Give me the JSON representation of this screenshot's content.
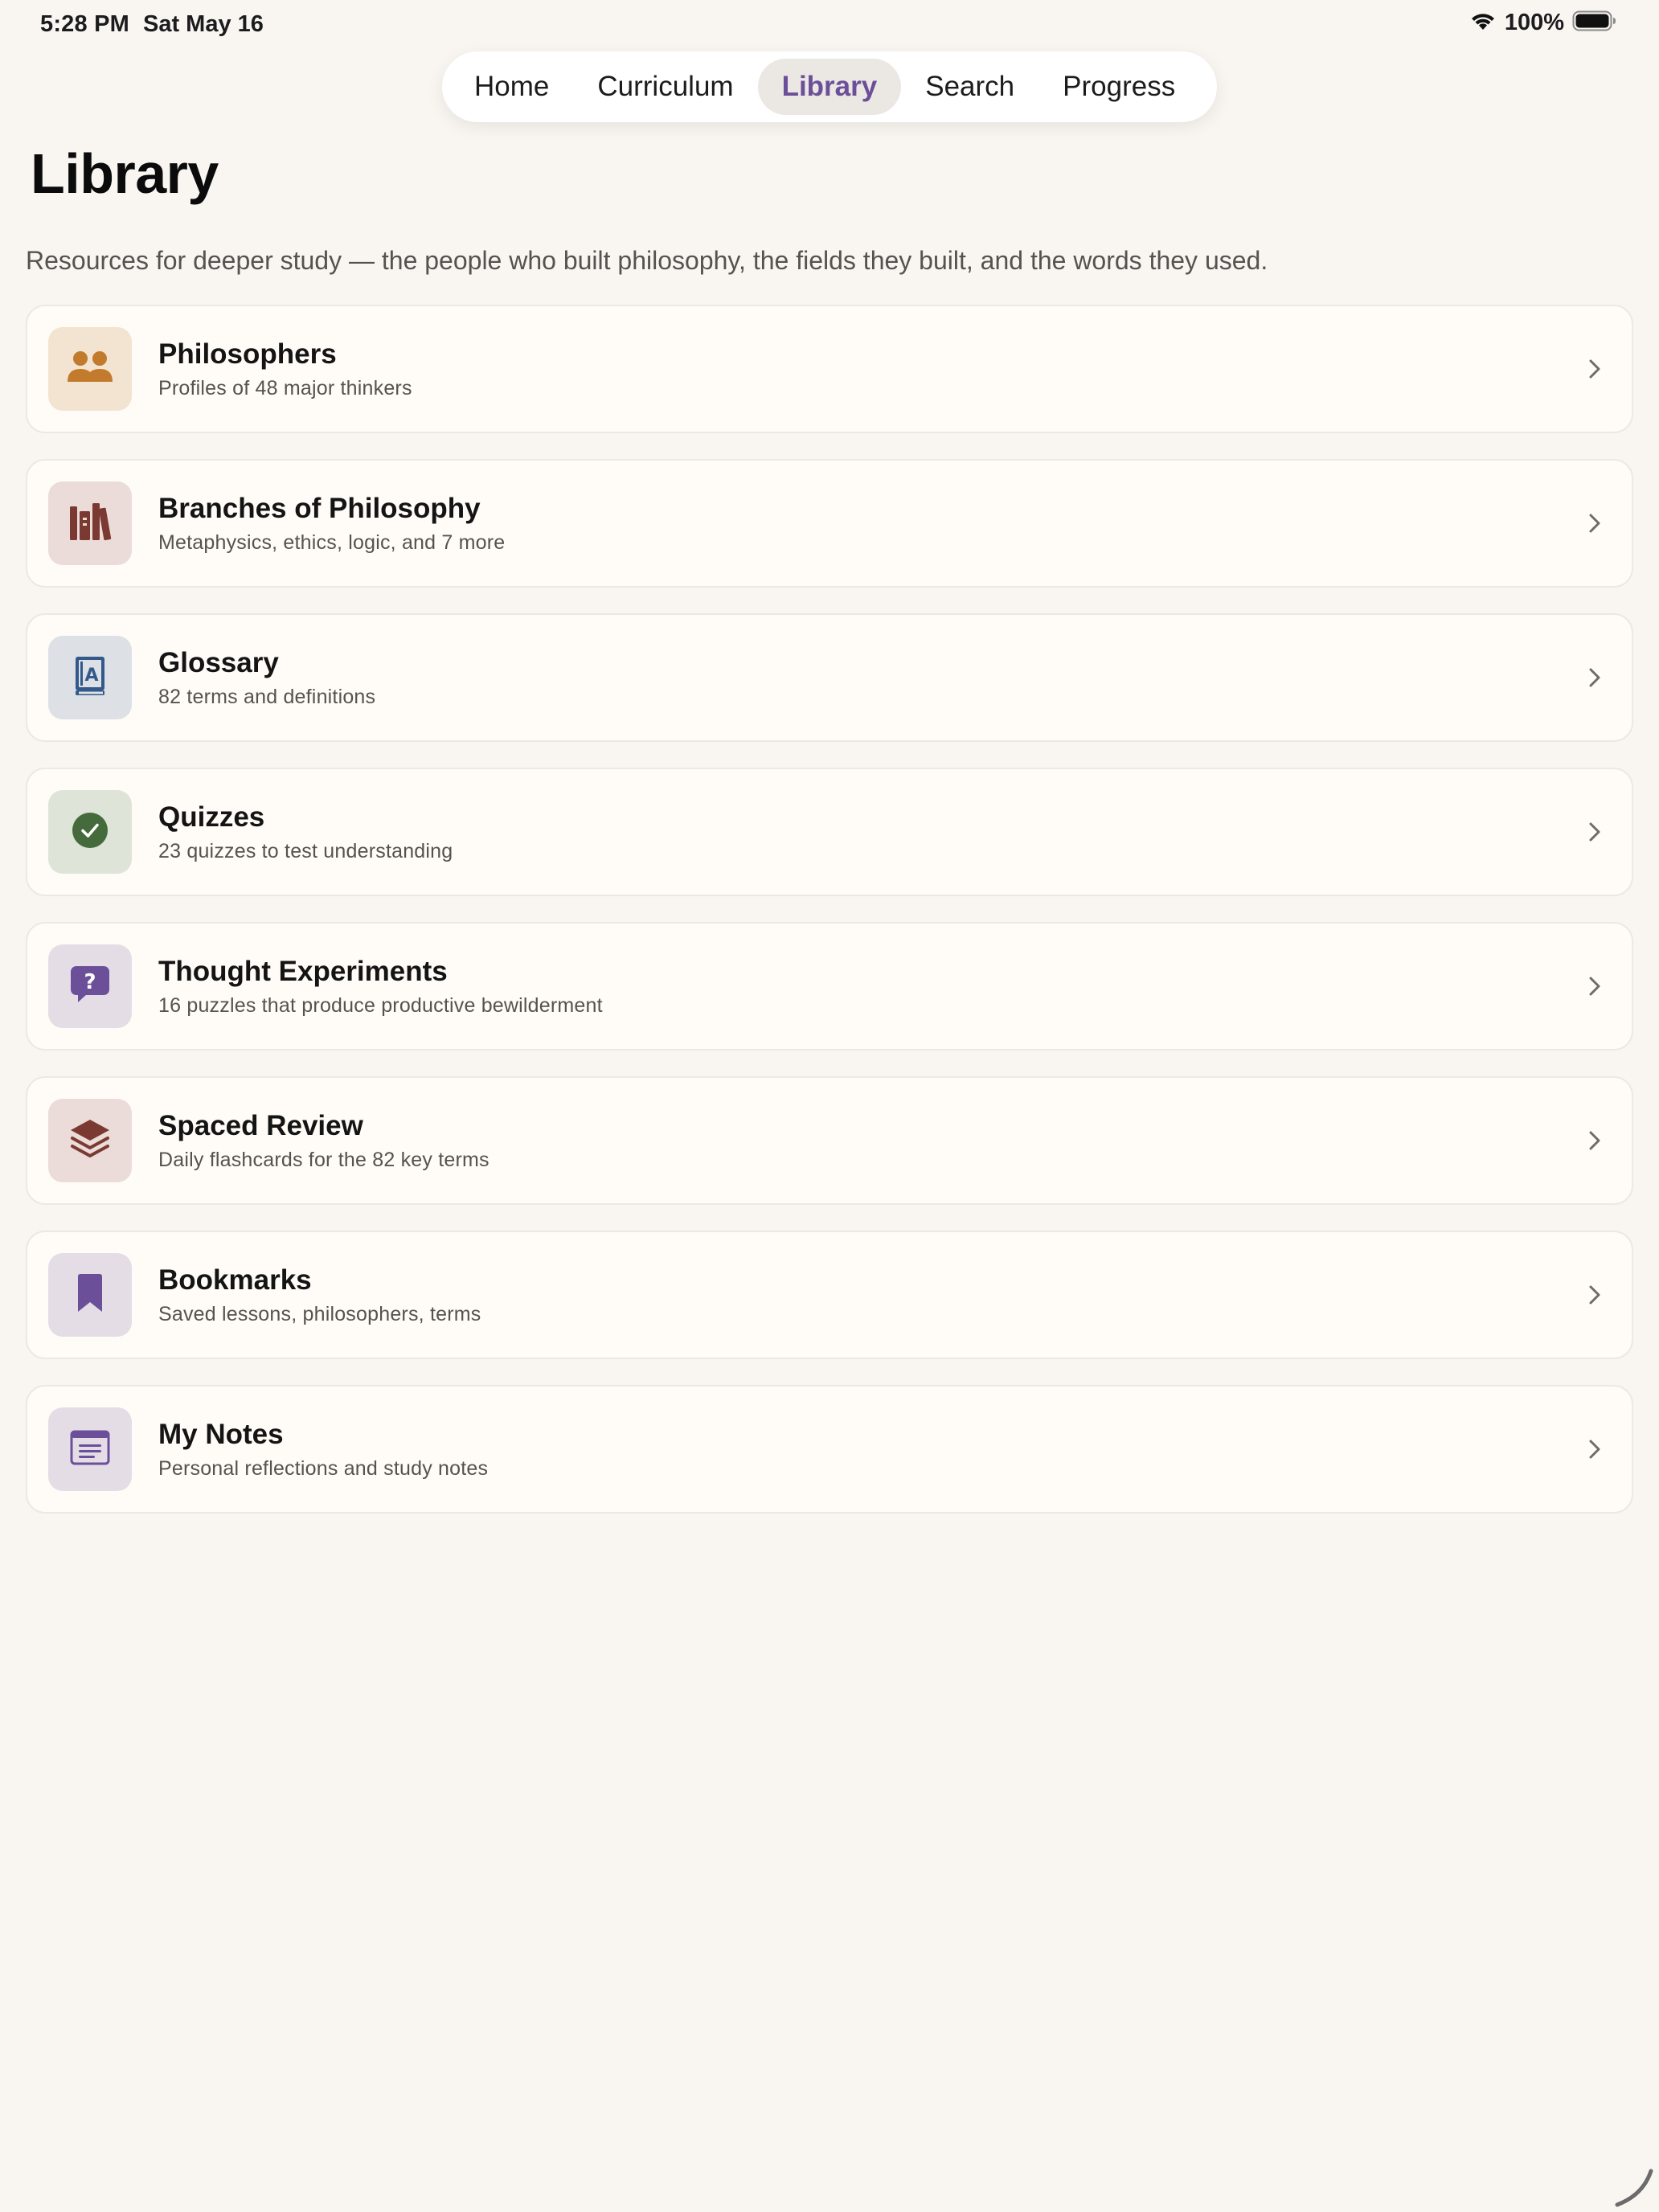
{
  "status_bar": {
    "time": "5:28 PM",
    "date": "Sat May 16",
    "battery_percent": "100%",
    "battery_level": 1.0
  },
  "tabs": [
    {
      "label": "Home",
      "active": false
    },
    {
      "label": "Curriculum",
      "active": false
    },
    {
      "label": "Library",
      "active": true
    },
    {
      "label": "Search",
      "active": false
    },
    {
      "label": "Progress",
      "active": false
    }
  ],
  "page": {
    "title": "Library",
    "subtitle": "Resources for deeper study — the people who built philosophy, the fields they built, and the words they used."
  },
  "items": [
    {
      "title": "Philosophers",
      "description": "Profiles of 48 major thinkers",
      "icon": "people-icon",
      "icon_color": "#c27a2c",
      "icon_bg": "#f3e4d1"
    },
    {
      "title": "Branches of Philosophy",
      "description": "Metaphysics, ethics, logic, and 7 more",
      "icon": "books-icon",
      "icon_color": "#7a3a32",
      "icon_bg": "#ebdcd9"
    },
    {
      "title": "Glossary",
      "description": "82 terms and definitions",
      "icon": "dictionary-icon",
      "icon_color": "#33598a",
      "icon_bg": "#dde1e6"
    },
    {
      "title": "Quizzes",
      "description": "23 quizzes to test understanding",
      "icon": "checkmark-circle-icon",
      "icon_color": "#456b3c",
      "icon_bg": "#dfe4d8"
    },
    {
      "title": "Thought Experiments",
      "description": "16 puzzles that produce productive bewilderment",
      "icon": "question-bubble-icon",
      "icon_color": "#6b4f99",
      "icon_bg": "#e4dde6"
    },
    {
      "title": "Spaced Review",
      "description": "Daily flashcards for the 82 key terms",
      "icon": "stack-icon",
      "icon_color": "#7a3a32",
      "icon_bg": "#ebdcd9"
    },
    {
      "title": "Bookmarks",
      "description": "Saved lessons, philosophers, terms",
      "icon": "bookmark-icon",
      "icon_color": "#6b4f99",
      "icon_bg": "#e4dde6"
    },
    {
      "title": "My Notes",
      "description": "Personal reflections and study notes",
      "icon": "notes-icon",
      "icon_color": "#6b4f99",
      "icon_bg": "#e4dde6"
    }
  ],
  "colors": {
    "background": "#f9f6f2",
    "card": "#fffcf7",
    "accent": "#6b4f99"
  }
}
